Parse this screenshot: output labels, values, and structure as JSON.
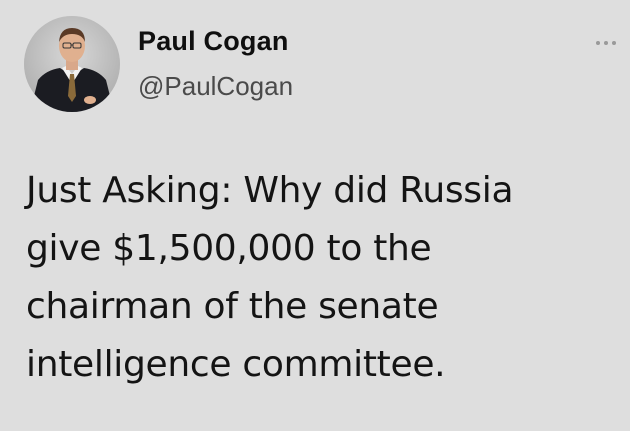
{
  "author": {
    "display_name": "Paul Cogan",
    "handle": "@PaulCogan",
    "avatar_icon": "profile-photo"
  },
  "menu": {
    "icon": "more-options-icon"
  },
  "tweet": {
    "lines": [
      "Just Asking: Why did Russia",
      "give $1,500,000 to the",
      "chairman of the senate",
      "intelligence committee."
    ]
  },
  "colors": {
    "background": "#dedede",
    "text": "#141414",
    "handle": "#4a4a4a",
    "muted_icon": "#9a9a9a"
  }
}
